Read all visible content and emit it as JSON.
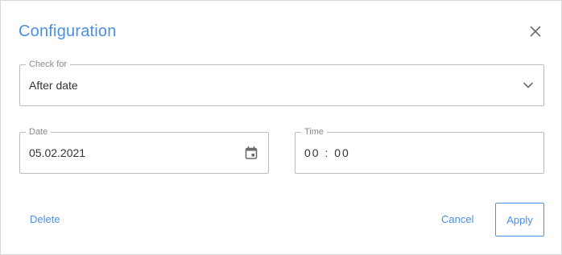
{
  "dialog": {
    "title": "Configuration",
    "close_icon": "close-icon"
  },
  "check_for": {
    "label": "Check for",
    "value": "After date",
    "icon": "chevron-down-icon"
  },
  "date": {
    "label": "Date",
    "value": "05.02.2021",
    "icon": "calendar-icon"
  },
  "time": {
    "label": "Time",
    "value": "00 : 00"
  },
  "actions": {
    "delete_label": "Delete",
    "cancel_label": "Cancel",
    "apply_label": "Apply"
  },
  "colors": {
    "accent": "#4a90e2",
    "border": "#bdbdbd",
    "label": "#8a8a8a",
    "text": "#333333"
  }
}
